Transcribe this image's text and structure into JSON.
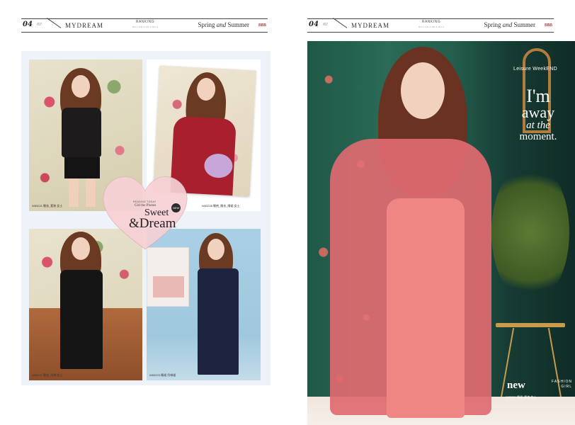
{
  "header_left": {
    "page_number": "04",
    "page_sub": "/67",
    "brand": "MYDREAM",
    "ranking": "RANKING",
    "ranking_sub": "NO.1   NO.2   NO.3   NO.4",
    "season_a": "Spring",
    "season_and": "and",
    "season_b": "Summer",
    "logo": "BBB"
  },
  "header_right": {
    "page_number": "04",
    "page_sub": "/67",
    "brand": "MYDREAM",
    "ranking": "RANKING",
    "ranking_sub": "NO.1   NO.2   NO.3   NO.4",
    "season_a": "Spring",
    "season_and": "and",
    "season_b": "Summer",
    "logo": "BBB"
  },
  "photos": {
    "p1_caption": "W83221 睡衣_套装 女士",
    "p2_caption": "W83228 睡袍_睡衣_睡裙 女士",
    "p3_caption": "W83221 睡衣_吊带 女士",
    "p4_caption": "W83223 睡裙 吊带裙"
  },
  "heart": {
    "small": "READING TODAY",
    "phrase": "Girl the Photos",
    "sweet": "Sweet",
    "dream": "&Dream",
    "badge": "NEW"
  },
  "right_page": {
    "leisure": "Leisure WeekEND",
    "quote_1": "I'm",
    "quote_2": "away",
    "quote_3": "at the",
    "quote_4": "moment.",
    "new": "new",
    "fashion": "FASHION",
    "girl": "GIRL",
    "caption": "W83229 睡裙_睡袍 女士"
  },
  "colors": {
    "panel_bg": "#eef3f9",
    "dress_coral": "#e9727a",
    "heart_pink": "#f6d1d5",
    "wall_green": "#245d4d"
  }
}
